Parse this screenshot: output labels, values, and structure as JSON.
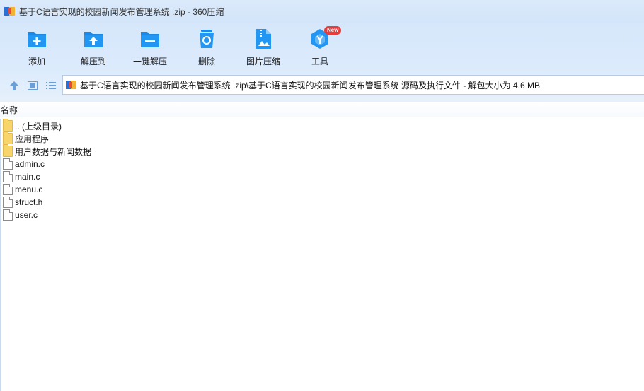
{
  "window": {
    "title": "基于C语言实现的校园新闻发布管理系统 .zip - 360压缩"
  },
  "toolbar": {
    "items": [
      {
        "label": "添加",
        "icon": "add-folder-icon"
      },
      {
        "label": "解压到",
        "icon": "extract-to-icon"
      },
      {
        "label": "一键解压",
        "icon": "one-click-extract-icon"
      },
      {
        "label": "删除",
        "icon": "trash-icon"
      },
      {
        "label": "图片压缩",
        "icon": "image-compress-icon"
      },
      {
        "label": "工具",
        "icon": "tools-icon",
        "badge": "New"
      }
    ]
  },
  "address": {
    "path": "基于C语言实现的校园新闻发布管理系统 .zip\\基于C语言实现的校园新闻发布管理系统 源码及执行文件 - 解包大小为 4.6 MB"
  },
  "list": {
    "column_name": "名称",
    "rows": [
      {
        "name": ".. (上级目录)",
        "type": "folder"
      },
      {
        "name": "应用程序",
        "type": "folder"
      },
      {
        "name": "用户数据与新闻数据",
        "type": "folder"
      },
      {
        "name": "admin.c",
        "type": "file"
      },
      {
        "name": "main.c",
        "type": "file"
      },
      {
        "name": "menu.c",
        "type": "file"
      },
      {
        "name": "struct.h",
        "type": "file"
      },
      {
        "name": "user.c",
        "type": "file"
      }
    ]
  },
  "colors": {
    "accent_blue": "#1e88e5",
    "toolbar_bg": "#d6e7fb",
    "badge_red": "#ea3b3b",
    "folder_yellow": "#f7d56a"
  }
}
